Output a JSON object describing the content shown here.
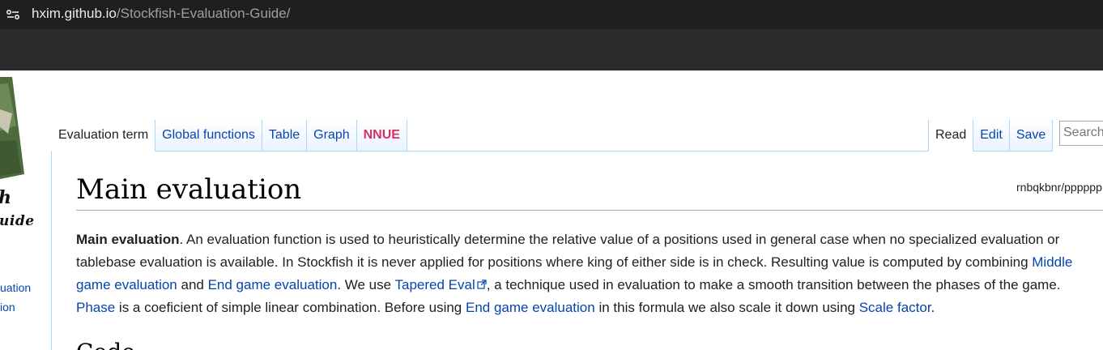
{
  "browser": {
    "url_host": "hxim.github.io",
    "url_path": "/Stockfish-Evaluation-Guide/"
  },
  "logo": {
    "text_line1": "h",
    "text_line2": "uide"
  },
  "sidebar": {
    "items": [
      {
        "label": "uation"
      },
      {
        "label": "ion"
      }
    ]
  },
  "tabs_left": [
    {
      "label": "Evaluation term"
    },
    {
      "label": "Global functions"
    },
    {
      "label": "Table"
    },
    {
      "label": "Graph"
    },
    {
      "label": "NNUE"
    }
  ],
  "tabs_right": [
    {
      "label": "Read"
    },
    {
      "label": "Edit"
    },
    {
      "label": "Save"
    }
  ],
  "search": {
    "placeholder": "Search"
  },
  "page": {
    "title": "Main evaluation",
    "fen": "rnbqkbnr/pppppp",
    "para": {
      "bold": "Main evaluation",
      "t1": ". An evaluation function is used to heuristically determine the relative value of a positions used in general case when no specialized evaluation or tablebase evaluation is available. In Stockfish it is never applied for positions where king of either side is in check. Resulting value is computed by combining ",
      "link_mg": "Middle game evaluation",
      "t2": " and ",
      "link_eg": "End game evaluation",
      "t3": ". We use ",
      "link_tapered": "Tapered Eval",
      "t4": ", a technique used in evaluation to make a smooth transition between the phases of the game. ",
      "link_phase": "Phase",
      "t5": " is a coeficient of simple linear combination. Before using ",
      "link_eg2": "End game evaluation",
      "t6": " in this formula we also scale it down using ",
      "link_scale": "Scale factor",
      "t7": "."
    },
    "next_heading": "Code"
  },
  "colors": {
    "link": "#0645ad",
    "nnue": "#d33361",
    "tab_border": "#a7d7f9",
    "chrome_dark": "#1f1f1f"
  }
}
